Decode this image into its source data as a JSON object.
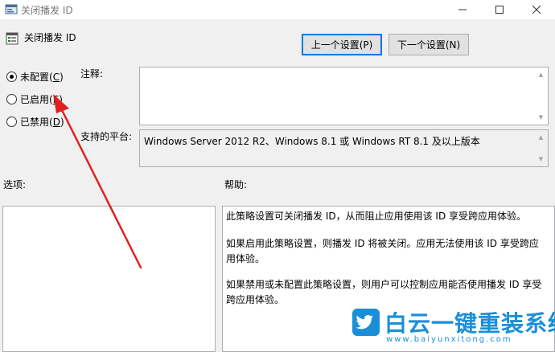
{
  "window": {
    "title": "关闭播发 ID",
    "controls": [
      "minimize-icon",
      "maximize-icon",
      "close-icon"
    ]
  },
  "header": {
    "policy_title": "关闭播发 ID",
    "prev_button": "上一个设置(P)",
    "next_button": "下一个设置(N)"
  },
  "options": {
    "not_configured": {
      "text": "未配置(",
      "key": "C",
      "end": ")",
      "checked": true
    },
    "enabled": {
      "text": "已启用(",
      "key": "E",
      "end": ")",
      "checked": false
    },
    "disabled": {
      "text": "已禁用(",
      "key": "D",
      "end": ")",
      "checked": false
    }
  },
  "labels": {
    "comment": "注释:",
    "platforms": "支持的平台:",
    "options": "选项:",
    "help": "帮助:"
  },
  "comment_value": "",
  "platforms_value": "Windows Server 2012 R2、Windows 8.1 或 Windows RT 8.1 及以上版本",
  "help_text": [
    "此策略设置可关闭播发 ID，从而阻止应用使用该 ID 享受跨应用体验。",
    "如果启用此策略设置，则播发 ID 将被关闭。应用无法使用该 ID 享受跨应用体验。",
    "如果禁用或未配置此策略设置，则用户可以控制应用能否使用播发 ID 享受跨应用体验。"
  ],
  "annotation": {
    "arrow_color": "#e02020"
  },
  "watermark": {
    "text": "白云一键重装系统",
    "url": "www.baiyunxitong.com",
    "color": "#1a8fd8"
  }
}
